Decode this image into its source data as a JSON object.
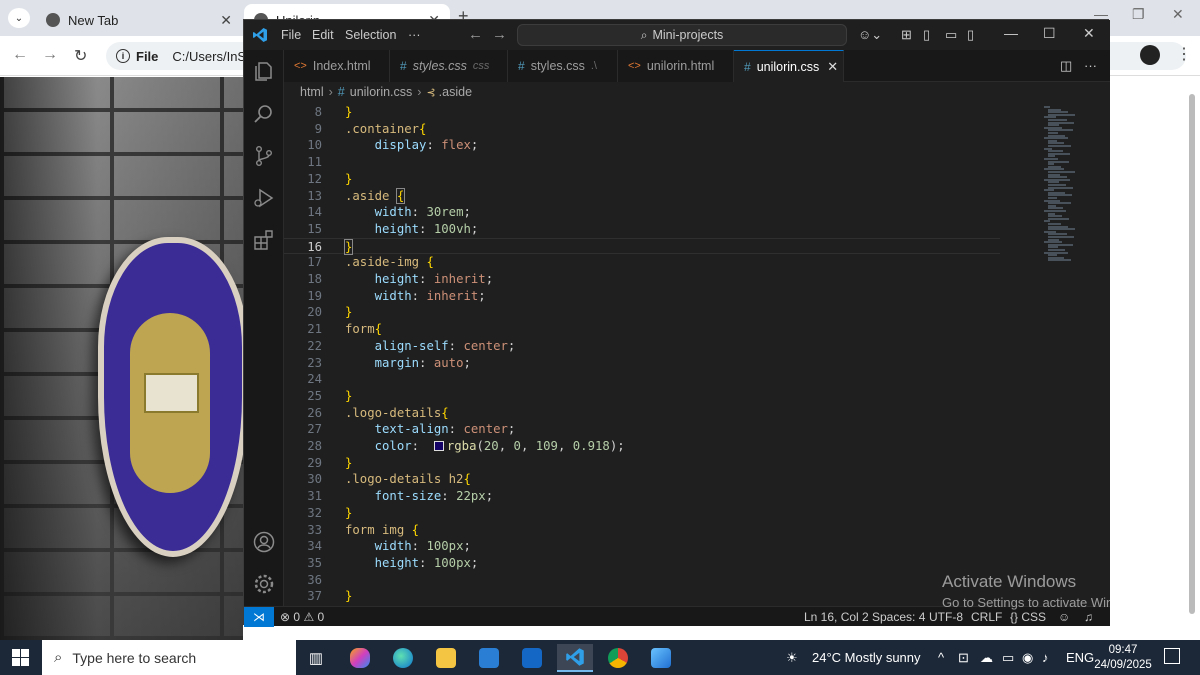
{
  "browser": {
    "tabs": [
      {
        "title": "New Tab"
      },
      {
        "title": "Unilorin"
      }
    ],
    "address": {
      "scheme_label": "File",
      "value": "C:/Users/InStep"
    }
  },
  "vscode": {
    "menu": [
      "File",
      "Edit",
      "Selection",
      "···"
    ],
    "command_center": "Mini-projects",
    "tabs": [
      {
        "label": "Index.html",
        "type": "html",
        "extra": "",
        "active": false,
        "italic": false
      },
      {
        "label": "styles.css",
        "type": "css",
        "extra": "css",
        "active": false,
        "italic": true
      },
      {
        "label": "styles.css",
        "type": "css",
        "extra": ".\\",
        "active": false,
        "italic": false
      },
      {
        "label": "unilorin.html",
        "type": "html",
        "extra": "",
        "active": false,
        "italic": false
      },
      {
        "label": "unilorin.css",
        "type": "css",
        "extra": "",
        "active": true,
        "italic": false
      }
    ],
    "breadcrumb": {
      "folder": "html",
      "file": "unilorin.css",
      "symbol": ".aside"
    },
    "current_line": 16,
    "code_lines": [
      {
        "n": "8",
        "tokens": [
          [
            "br",
            "}"
          ]
        ]
      },
      {
        "n": "9",
        "tokens": [
          [
            "sel",
            ".container"
          ],
          [
            "br",
            "{"
          ]
        ]
      },
      {
        "n": "10",
        "tokens": [
          [
            "sp",
            "    "
          ],
          [
            "prop",
            "display"
          ],
          [
            "punc",
            ": "
          ],
          [
            "val",
            "flex"
          ],
          [
            "punc",
            ";"
          ]
        ]
      },
      {
        "n": "11",
        "tokens": []
      },
      {
        "n": "12",
        "tokens": [
          [
            "br",
            "}"
          ]
        ]
      },
      {
        "n": "13",
        "tokens": [
          [
            "sel",
            ".aside "
          ],
          [
            "brhl",
            "{"
          ]
        ]
      },
      {
        "n": "14",
        "tokens": [
          [
            "sp",
            "    "
          ],
          [
            "prop",
            "width"
          ],
          [
            "punc",
            ": "
          ],
          [
            "num",
            "30rem"
          ],
          [
            "punc",
            ";"
          ]
        ]
      },
      {
        "n": "15",
        "tokens": [
          [
            "sp",
            "    "
          ],
          [
            "prop",
            "height"
          ],
          [
            "punc",
            ": "
          ],
          [
            "num",
            "100vh"
          ],
          [
            "punc",
            ";"
          ]
        ]
      },
      {
        "n": "16",
        "tokens": [
          [
            "brhl",
            "}"
          ]
        ]
      },
      {
        "n": "17",
        "tokens": [
          [
            "sel",
            ".aside-img "
          ],
          [
            "br",
            "{"
          ]
        ]
      },
      {
        "n": "18",
        "tokens": [
          [
            "sp",
            "    "
          ],
          [
            "prop",
            "height"
          ],
          [
            "punc",
            ": "
          ],
          [
            "val",
            "inherit"
          ],
          [
            "punc",
            ";"
          ]
        ]
      },
      {
        "n": "19",
        "tokens": [
          [
            "sp",
            "    "
          ],
          [
            "prop",
            "width"
          ],
          [
            "punc",
            ": "
          ],
          [
            "val",
            "inherit"
          ],
          [
            "punc",
            ";"
          ]
        ]
      },
      {
        "n": "20",
        "tokens": [
          [
            "br",
            "}"
          ]
        ]
      },
      {
        "n": "21",
        "tokens": [
          [
            "sel",
            "form"
          ],
          [
            "br",
            "{"
          ]
        ]
      },
      {
        "n": "22",
        "tokens": [
          [
            "sp",
            "    "
          ],
          [
            "prop",
            "align-self"
          ],
          [
            "punc",
            ": "
          ],
          [
            "val",
            "center"
          ],
          [
            "punc",
            ";"
          ]
        ]
      },
      {
        "n": "23",
        "tokens": [
          [
            "sp",
            "    "
          ],
          [
            "prop",
            "margin"
          ],
          [
            "punc",
            ": "
          ],
          [
            "val",
            "auto"
          ],
          [
            "punc",
            ";"
          ]
        ]
      },
      {
        "n": "24",
        "tokens": []
      },
      {
        "n": "25",
        "tokens": [
          [
            "br",
            "}"
          ]
        ]
      },
      {
        "n": "26",
        "tokens": [
          [
            "sel",
            ".logo-details"
          ],
          [
            "br",
            "{"
          ]
        ]
      },
      {
        "n": "27",
        "tokens": [
          [
            "sp",
            "    "
          ],
          [
            "prop",
            "text-align"
          ],
          [
            "punc",
            ": "
          ],
          [
            "val",
            "center"
          ],
          [
            "punc",
            ";"
          ]
        ]
      },
      {
        "n": "28",
        "tokens": [
          [
            "sp",
            "    "
          ],
          [
            "prop",
            "color"
          ],
          [
            "punc",
            ":  "
          ],
          [
            "swatch",
            ""
          ],
          [
            "fn",
            "rgba"
          ],
          [
            "punc",
            "("
          ],
          [
            "num",
            "20"
          ],
          [
            "punc",
            ", "
          ],
          [
            "num",
            "0"
          ],
          [
            "punc",
            ", "
          ],
          [
            "num",
            "109"
          ],
          [
            "punc",
            ", "
          ],
          [
            "num",
            "0.918"
          ],
          [
            "punc",
            ");"
          ]
        ]
      },
      {
        "n": "29",
        "tokens": [
          [
            "br",
            "}"
          ]
        ]
      },
      {
        "n": "30",
        "tokens": [
          [
            "sel",
            ".logo-details h2"
          ],
          [
            "br",
            "{"
          ]
        ]
      },
      {
        "n": "31",
        "tokens": [
          [
            "sp",
            "    "
          ],
          [
            "prop",
            "font-size"
          ],
          [
            "punc",
            ": "
          ],
          [
            "num",
            "22px"
          ],
          [
            "punc",
            ";"
          ]
        ]
      },
      {
        "n": "32",
        "tokens": [
          [
            "br",
            "}"
          ]
        ]
      },
      {
        "n": "33",
        "tokens": [
          [
            "sel",
            "form img "
          ],
          [
            "br",
            "{"
          ]
        ]
      },
      {
        "n": "34",
        "tokens": [
          [
            "sp",
            "    "
          ],
          [
            "prop",
            "width"
          ],
          [
            "punc",
            ": "
          ],
          [
            "num",
            "100px"
          ],
          [
            "punc",
            ";"
          ]
        ]
      },
      {
        "n": "35",
        "tokens": [
          [
            "sp",
            "    "
          ],
          [
            "prop",
            "height"
          ],
          [
            "punc",
            ": "
          ],
          [
            "num",
            "100px"
          ],
          [
            "punc",
            ";"
          ]
        ]
      },
      {
        "n": "36",
        "tokens": []
      },
      {
        "n": "37",
        "tokens": [
          [
            "br",
            "}"
          ]
        ]
      }
    ],
    "status": {
      "errors": "0",
      "warnings": "0",
      "position": "Ln 16, Col 2",
      "spaces": "Spaces: 4",
      "encoding": "UTF-8",
      "eol": "CRLF",
      "language": "CSS"
    }
  },
  "watermark": {
    "line1": "Activate Windows",
    "line2": "Go to Settings to activate Windows."
  },
  "taskbar": {
    "search_placeholder": "Type here to search",
    "weather": "24°C  Mostly sunny",
    "language": "ENG",
    "time": "09:47",
    "date": "24/09/2025"
  },
  "colors": {
    "accent": "#0078d4",
    "editor_bg": "#1f1f1f",
    "selector": "#d7ba7d",
    "property": "#9cdcfe",
    "value": "#ce9178",
    "number": "#b5cea8",
    "bracket": "#ffd700",
    "taskbar": "#1c2838"
  }
}
